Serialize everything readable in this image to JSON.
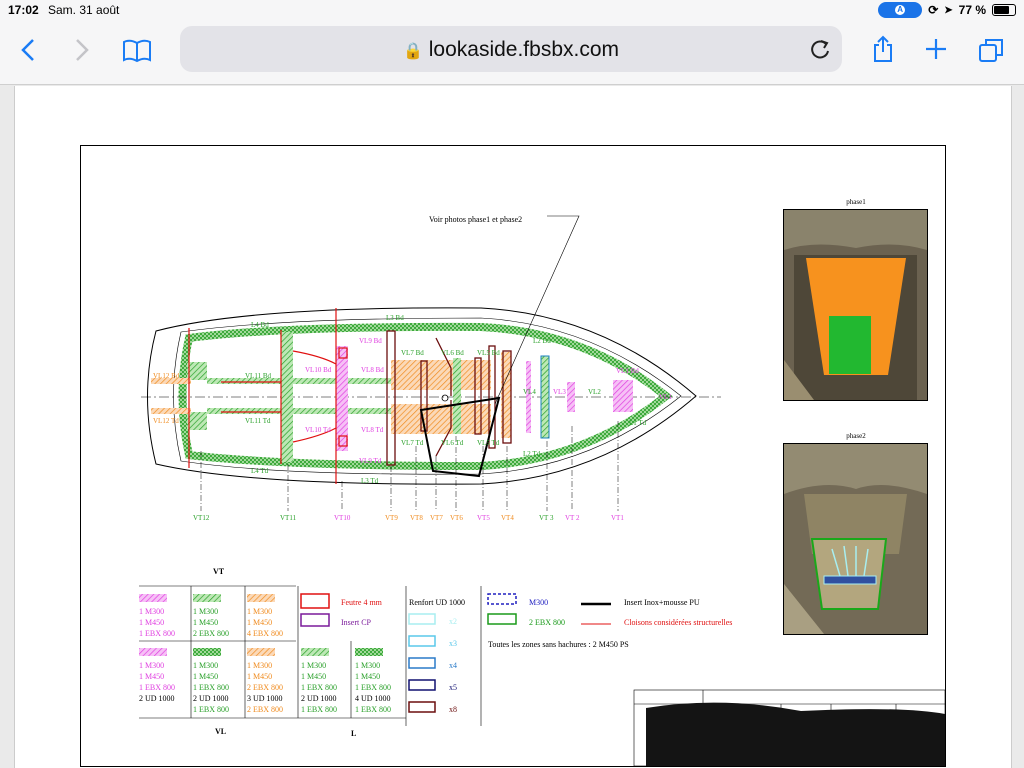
{
  "status": {
    "time": "17:02",
    "date": "Sam. 31 août",
    "battery": "77 %",
    "nav_letter": "A"
  },
  "browser": {
    "url": "lookaside.fbsbx.com"
  },
  "drawing": {
    "annotation": "Voir photos phase1 et phase2",
    "photo1_caption": "phase1",
    "photo2_caption": "phase2",
    "labels": [
      {
        "text": "L4 Bd",
        "c": "#2aa02a"
      },
      {
        "text": "L3 Bd",
        "c": "#2aa02a"
      },
      {
        "text": "VL9 Bd",
        "c": "#e040e0"
      },
      {
        "text": "VL7 Bd",
        "c": "#2aa02a"
      },
      {
        "text": "VL6 Bd",
        "c": "#2aa02a"
      },
      {
        "text": "VL5 Bd",
        "c": "#2aa02a"
      },
      {
        "text": "VL12 Bd",
        "c": "#f08c20"
      },
      {
        "text": "VL11 Bd",
        "c": "#2aa02a"
      },
      {
        "text": "VL10 Bd",
        "c": "#e040e0"
      },
      {
        "text": "VL8 Bd",
        "c": "#e040e0"
      },
      {
        "text": "VL4",
        "c": "#2aa02a"
      },
      {
        "text": "VL3",
        "c": "#e040e0"
      },
      {
        "text": "VL2",
        "c": "#2aa02a"
      },
      {
        "text": "VL1 Bd",
        "c": "#e040e0"
      },
      {
        "text": "VL1",
        "c": "#e040e0"
      },
      {
        "text": "VL12 Td",
        "c": "#f08c20"
      },
      {
        "text": "VL11 Td",
        "c": "#2aa02a"
      },
      {
        "text": "VL10 Td",
        "c": "#e040e0"
      },
      {
        "text": "VL8 Td",
        "c": "#e040e0"
      },
      {
        "text": "VL7 Td",
        "c": "#2aa02a"
      },
      {
        "text": "VL6 Td",
        "c": "#2aa02a"
      },
      {
        "text": "VL5 Td",
        "c": "#2aa02a"
      },
      {
        "text": "L2 Td",
        "c": "#2aa02a"
      },
      {
        "text": "L1 Td",
        "c": "#2aa02a"
      },
      {
        "text": "L4 Td",
        "c": "#2aa02a"
      },
      {
        "text": "VL9 Td",
        "c": "#e040e0"
      },
      {
        "text": "L3 Td",
        "c": "#2aa02a"
      },
      {
        "text": "L2 Bd",
        "c": "#2aa02a"
      }
    ],
    "stations": [
      {
        "text": "VT12",
        "c": "#2aa02a"
      },
      {
        "text": "VT11",
        "c": "#2aa02a"
      },
      {
        "text": "VT10",
        "c": "#e040e0"
      },
      {
        "text": "VT9",
        "c": "#f08c20"
      },
      {
        "text": "VT8",
        "c": "#f08c20"
      },
      {
        "text": "VT7",
        "c": "#f08c20"
      },
      {
        "text": "VT6",
        "c": "#f08c20"
      },
      {
        "text": "VT5",
        "c": "#e040e0"
      },
      {
        "text": "VT4",
        "c": "#f08c20"
      },
      {
        "text": "VT 3",
        "c": "#2aa02a"
      },
      {
        "text": "VT 2",
        "c": "#e040e0"
      },
      {
        "text": "VT1",
        "c": "#e040e0"
      }
    ],
    "legend": {
      "vt_title": "VT",
      "vl_title": "VL",
      "l_title": "L",
      "vt_cells": [
        {
          "c": "#e040e0",
          "lines": [
            "1 M300",
            "1 M450",
            "1 EBX 800"
          ]
        },
        {
          "c": "#2aa02a",
          "lines": [
            "1 M300",
            "1 M450",
            "2 EBX 800"
          ]
        },
        {
          "c": "#f08c20",
          "lines": [
            "1 M300",
            "1 M450",
            "4 EBX 800"
          ]
        }
      ],
      "vl_cells": [
        {
          "c": "#e040e0",
          "lines": [
            "1 M300",
            "1 M450",
            "1 EBX 800",
            "2 UD 1000"
          ]
        },
        {
          "c": "#2aa02a",
          "lines": [
            "1 M300",
            "1 M450",
            "1 EBX 800",
            "2 UD 1000",
            "1 EBX 800"
          ]
        },
        {
          "c": "#f08c20",
          "lines": [
            "1 M300",
            "1 M450",
            "2 EBX 800",
            "3 UD 1000",
            "2 EBX 800"
          ]
        }
      ],
      "l_cells": [
        {
          "c": "#2aa02a",
          "lines": [
            "1 M300",
            "1 M450",
            "1 EBX 800",
            "2 UD 1000",
            "1 EBX 800"
          ]
        },
        {
          "c": "#2aa02a",
          "lines": [
            "1 M300",
            "1 M450",
            "1 EBX 800",
            "4 UD 1000",
            "1 EBX 800"
          ]
        }
      ],
      "feutre": "Feutre 4 mm",
      "insert_cp": "Insert CP",
      "renfort": "Renfort UD 1000",
      "x2": "x2",
      "x3": "x3",
      "x4": "x4",
      "x5": "x5",
      "x8": "x8",
      "m300": "M300",
      "ebx": "2 EBX 800",
      "inox": "Insert Inox+mousse PU",
      "cloisons": "Cloisons considérées structurelles",
      "note": "Toutes les zones sans hachures : 2 M450 PS"
    }
  }
}
